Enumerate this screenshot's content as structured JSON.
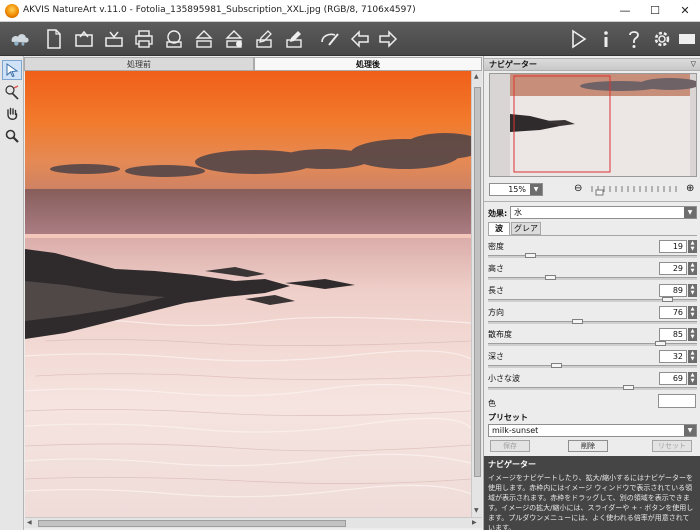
{
  "window": {
    "title": "AKVIS NatureArt v.11.0 - Fotolia_135895981_Subscription_XXL.jpg (RGB/8, 7106x4597)",
    "minimize": "—",
    "maximize": "☐",
    "close": "✕"
  },
  "toolbar": {
    "left_icons": [
      "app-logo-icon",
      "new-file-icon",
      "open-file-icon",
      "save-file-icon",
      "print-icon",
      "share-icon",
      "batch-icon",
      "export-icon",
      "import-icon",
      "edit-icon",
      "brush-icon",
      "undo-icon",
      "redo-icon"
    ],
    "right_icons": [
      "run-icon",
      "info-icon",
      "help-icon",
      "settings-icon",
      "background-icon"
    ]
  },
  "tools": [
    "select-tool-icon",
    "brush-tool-icon",
    "hand-tool-icon",
    "zoom-tool-icon"
  ],
  "tabs": {
    "before": "処理前",
    "after": "処理後"
  },
  "panel": {
    "navigator_title": "ナビゲーター",
    "zoom_value": "15%",
    "effect_label": "効果:",
    "effect_value": "水",
    "subtabs": {
      "wave": "波",
      "glare": "グレア"
    },
    "params": [
      {
        "label": "密度",
        "value": "19",
        "pct": 0.19
      },
      {
        "label": "高さ",
        "value": "29",
        "pct": 0.29
      },
      {
        "label": "長さ",
        "value": "89",
        "pct": 0.89
      },
      {
        "label": "方向",
        "value": "76",
        "pct": 0.43
      },
      {
        "label": "散布度",
        "value": "85",
        "pct": 0.85
      },
      {
        "label": "深さ",
        "value": "32",
        "pct": 0.32
      },
      {
        "label": "小さな波",
        "value": "69",
        "pct": 0.69
      }
    ],
    "color_label": "色",
    "preset_title": "プリセット",
    "preset_value": "milk-sunset",
    "preset_buttons": {
      "save": "保存",
      "delete": "削除",
      "reset": "リセット"
    },
    "help_title": "ナビゲーター",
    "help_body": "イメージをナビゲートしたり、拡大/縮小するにはナビゲーターを使用します。赤枠内にはイメージ ウィンドウで表示されている領域が表示されます。赤枠をドラッグして、別の領域を表示できます。イメージの拡大/縮小には、スライダーや + - ボタンを使用します。プルダウンメニューには、よく使われる倍率が用意されています。"
  },
  "colors": {
    "toolbar": "#4f4f4f",
    "sky_top": "#f26f1f",
    "sea": "#f3dfdb"
  }
}
